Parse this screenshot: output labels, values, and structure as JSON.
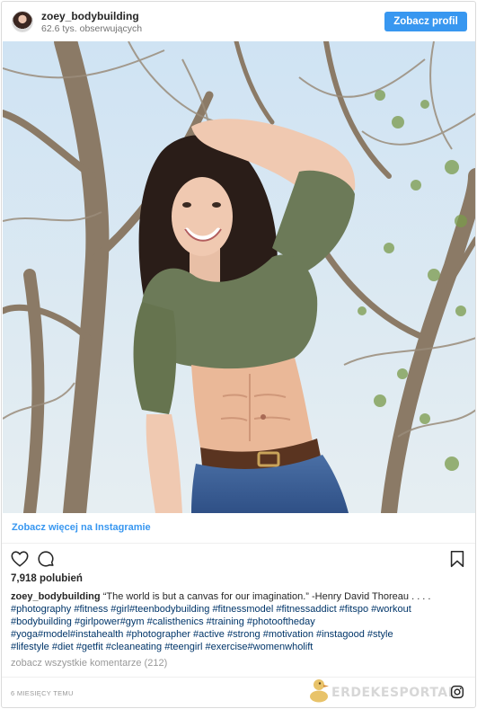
{
  "header": {
    "username": "zoey_bodybuilding",
    "followers": "62.6 tys. obserwujących",
    "profile_button": "Zobacz profil"
  },
  "photo": {
    "description_icon": "photo-image"
  },
  "see_more": "Zobacz więcej na Instagramie",
  "actions": {
    "like_icon": "heart-icon",
    "comment_icon": "comment-icon",
    "save_icon": "bookmark-icon"
  },
  "likes": "7,918 polubień",
  "caption": {
    "user": "zoey_bodybuilding",
    "text": "“The world is but a canvas for our imagination.” -Henry David Thoreau . . . .",
    "hashtag_lines": [
      "#photography #fitness #girl#teenbodybuilding #fitnessmodel #fitnessaddict #fitspo #workout",
      "#bodybuilding #girlpower#gym #calisthenics #training #photooftheday",
      "#yoga#model#instahealth #photographer #active #strong #motivation #instagood #style",
      "#lifestyle #diet #getfit #cleaneating #teengirl #exercise#womenwholift"
    ]
  },
  "comments_link": "zobacz wszystkie komentarze (212)",
  "time": "6 MIESIĘCY TEMU",
  "watermark": "ERDEKESPORTAL",
  "colors": {
    "accent": "#3897f0",
    "hashtag": "#003569",
    "muted": "#999999"
  }
}
